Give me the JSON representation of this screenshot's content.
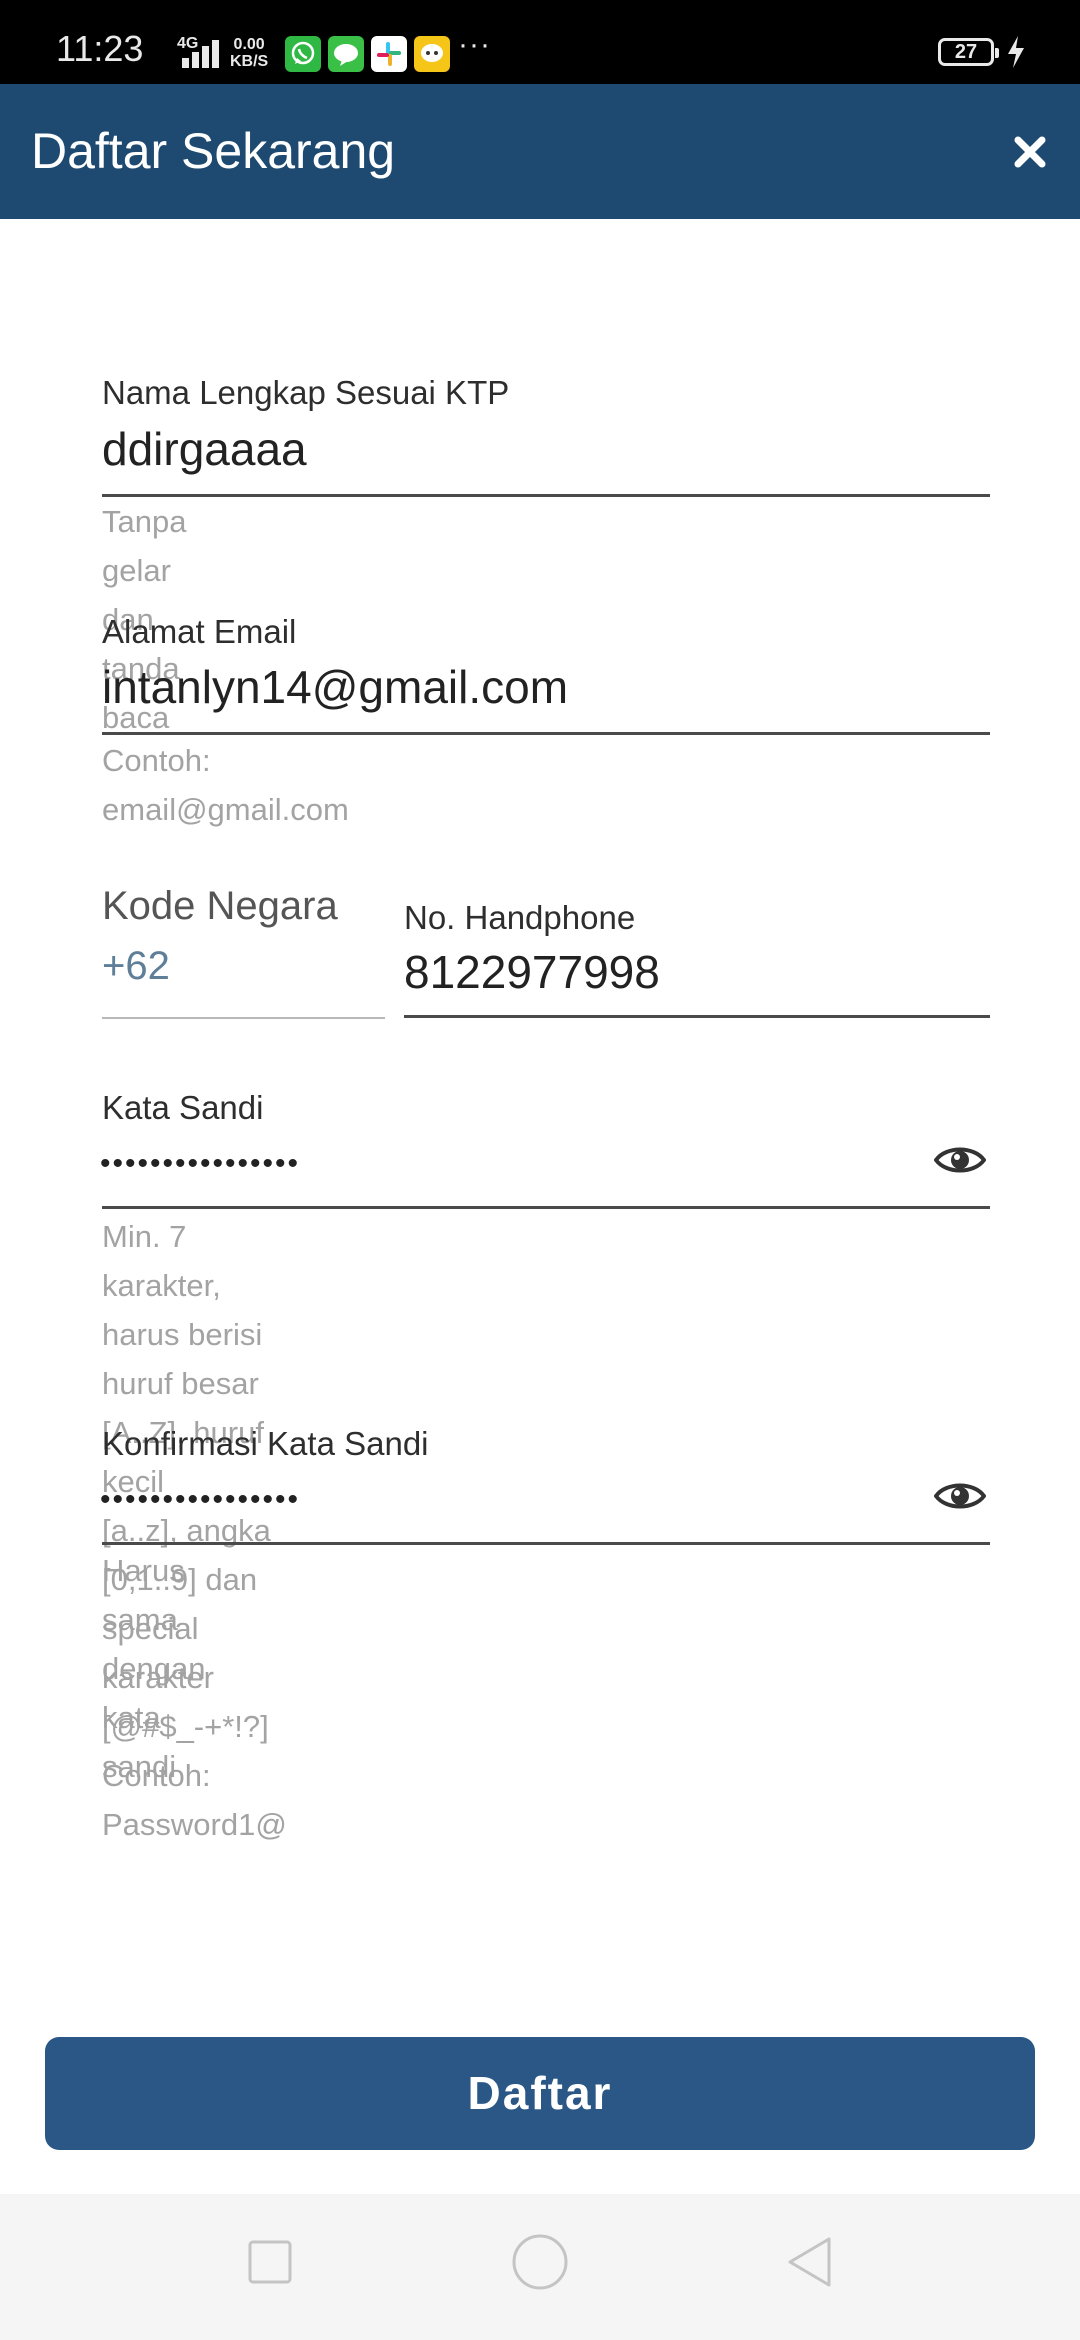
{
  "status_bar": {
    "time": "11:23",
    "network": "4G",
    "speed_value": "0.00",
    "speed_unit": "KB/S",
    "battery": "27",
    "apps": [
      "whatsapp-icon",
      "line-icon",
      "slack-icon",
      "chat-icon"
    ]
  },
  "header": {
    "title": "Daftar Sekarang",
    "close_icon": "close-icon"
  },
  "form": {
    "full_name": {
      "label": "Nama Lengkap Sesuai KTP",
      "value": "ddirgaaaa",
      "hint": "Tanpa gelar dan tanda baca"
    },
    "email": {
      "label": "Alamat Email",
      "value": "intanlyn14@gmail.com",
      "hint": "Contoh: email@gmail.com"
    },
    "country_code": {
      "label": "Kode Negara",
      "value": "+62"
    },
    "phone": {
      "label": "No. Handphone",
      "value": "8122977998"
    },
    "password": {
      "label": "Kata Sandi",
      "value": "••••••••••••••••",
      "hint_line1": "Min. 7 karakter, harus berisi huruf besar [A..Z], huruf kecil",
      "hint_line2": "[a..z], angka [0,1..9] dan special karakter [@#$_-+*!?]",
      "hint_line3": "Contoh: Password1@"
    },
    "confirm_password": {
      "label": "Konfirmasi Kata Sandi",
      "value": "••••••••••••••••",
      "hint": "Harus sama dengan kata sandi"
    }
  },
  "submit": {
    "label": "Daftar"
  },
  "colors": {
    "header_bg": "#1e4a72",
    "button_bg": "#2b5786",
    "country_code_text": "#5f7f99"
  }
}
